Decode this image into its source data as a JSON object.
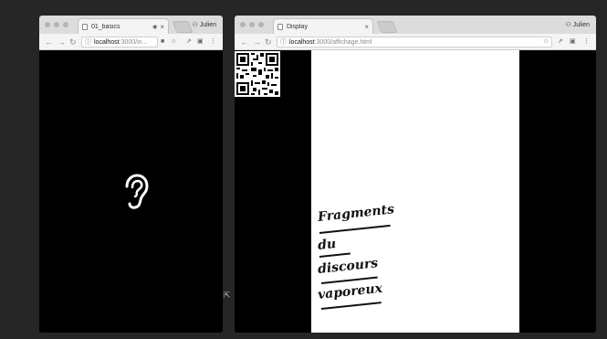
{
  "left_window": {
    "tab_title": "01_basics",
    "tab_recording": "◉",
    "tab_close": "×",
    "profile": "Julien",
    "url_host": "localhost",
    "url_path": ":3000/in...",
    "content_icon": "ear-icon"
  },
  "right_window": {
    "tab_title": "Display",
    "tab_close": "×",
    "profile": "Julien",
    "url_host": "localhost",
    "url_path": ":3000/affichage.html",
    "qr_icon": "qr-code-icon",
    "poem": {
      "line1": "Fragments",
      "line2": "du",
      "line3": "discours",
      "line4": "vaporeux"
    }
  },
  "colors": {
    "background": "#262626",
    "chrome": "#dcdcdc",
    "page": "#ffffff",
    "ink": "#111111"
  }
}
